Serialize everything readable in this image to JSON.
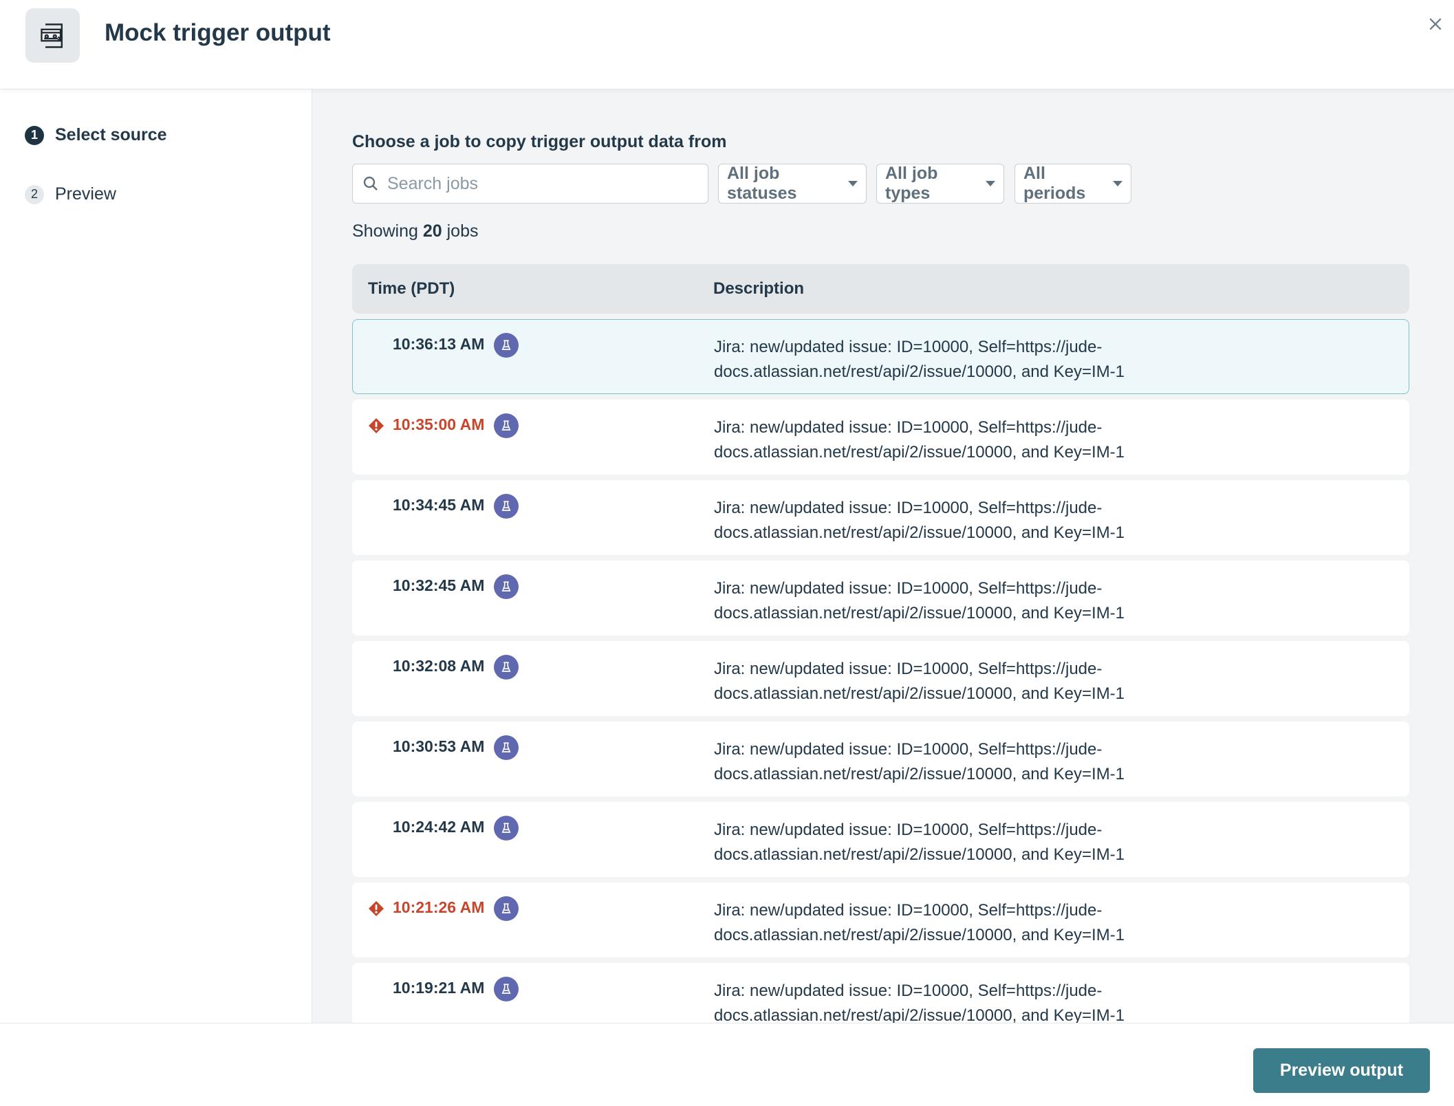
{
  "header": {
    "title": "Mock trigger output",
    "icon": "cassette-tape-icon",
    "close_icon": "close-icon"
  },
  "sidebar": {
    "steps": [
      {
        "number": "1",
        "label": "Select source",
        "active": true
      },
      {
        "number": "2",
        "label": "Preview",
        "active": false
      }
    ]
  },
  "main": {
    "section_title": "Choose a job to copy trigger output data from",
    "search": {
      "placeholder": "Search jobs",
      "value": ""
    },
    "filters": [
      {
        "label": "All job statuses"
      },
      {
        "label": "All job types"
      },
      {
        "label": "All periods"
      }
    ],
    "showing": {
      "prefix": "Showing",
      "count": "20",
      "suffix": "jobs"
    },
    "table": {
      "columns": [
        "Time (PDT)",
        "Description"
      ],
      "rows": [
        {
          "time": "10:36:13 AM",
          "status": "success",
          "selected": true,
          "type_icon": "flask-icon",
          "description": "Jira: new/updated issue: ID=10000, Self=https://jude-docs.atlassian.net/rest/api/2/issue/10000, and Key=IM-1"
        },
        {
          "time": "10:35:00 AM",
          "status": "error",
          "selected": false,
          "type_icon": "flask-icon",
          "description": "Jira: new/updated issue: ID=10000, Self=https://jude-docs.atlassian.net/rest/api/2/issue/10000, and Key=IM-1"
        },
        {
          "time": "10:34:45 AM",
          "status": "success",
          "selected": false,
          "type_icon": "flask-icon",
          "description": "Jira: new/updated issue: ID=10000, Self=https://jude-docs.atlassian.net/rest/api/2/issue/10000, and Key=IM-1"
        },
        {
          "time": "10:32:45 AM",
          "status": "success",
          "selected": false,
          "type_icon": "flask-icon",
          "description": "Jira: new/updated issue: ID=10000, Self=https://jude-docs.atlassian.net/rest/api/2/issue/10000, and Key=IM-1"
        },
        {
          "time": "10:32:08 AM",
          "status": "success",
          "selected": false,
          "type_icon": "flask-icon",
          "description": "Jira: new/updated issue: ID=10000, Self=https://jude-docs.atlassian.net/rest/api/2/issue/10000, and Key=IM-1"
        },
        {
          "time": "10:30:53 AM",
          "status": "success",
          "selected": false,
          "type_icon": "flask-icon",
          "description": "Jira: new/updated issue: ID=10000, Self=https://jude-docs.atlassian.net/rest/api/2/issue/10000, and Key=IM-1"
        },
        {
          "time": "10:24:42 AM",
          "status": "success",
          "selected": false,
          "type_icon": "flask-icon",
          "description": "Jira: new/updated issue: ID=10000, Self=https://jude-docs.atlassian.net/rest/api/2/issue/10000, and Key=IM-1"
        },
        {
          "time": "10:21:26 AM",
          "status": "error",
          "selected": false,
          "type_icon": "flask-icon",
          "description": "Jira: new/updated issue: ID=10000, Self=https://jude-docs.atlassian.net/rest/api/2/issue/10000, and Key=IM-1"
        },
        {
          "time": "10:19:21 AM",
          "status": "success",
          "selected": false,
          "type_icon": "flask-icon",
          "description": "Jira: new/updated issue: ID=10000, Self=https://jude-docs.atlassian.net/rest/api/2/issue/10000, and Key=IM-1"
        }
      ]
    }
  },
  "footer": {
    "primary_label": "Preview output"
  },
  "colors": {
    "primary": "#3b7d8a",
    "error": "#c8442b",
    "flask_badge": "#6068b0",
    "selected_row_bg": "#eef7f9",
    "selected_row_border": "#7cc5cd",
    "text": "#23394a"
  }
}
